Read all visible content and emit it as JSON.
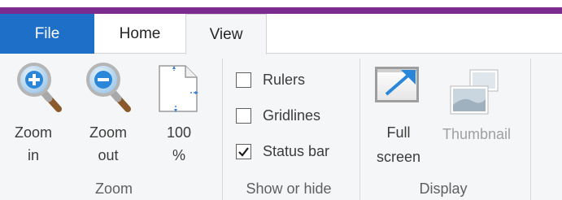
{
  "tabs": {
    "file": "File",
    "home": "Home",
    "view": "View"
  },
  "zoom_group": {
    "zoom_in": {
      "line1": "Zoom",
      "line2": "in"
    },
    "zoom_out": {
      "line1": "Zoom",
      "line2": "out"
    },
    "hundred": {
      "line1": "100",
      "line2": "%"
    },
    "label": "Zoom"
  },
  "show_hide_group": {
    "rulers": {
      "label": "Rulers",
      "checked": false
    },
    "gridlines": {
      "label": "Gridlines",
      "checked": false
    },
    "status_bar": {
      "label": "Status bar",
      "checked": true
    },
    "label": "Show or hide"
  },
  "display_group": {
    "full_screen": {
      "line1": "Full",
      "line2": "screen"
    },
    "thumbnail": {
      "label": "Thumbnail",
      "disabled": true
    },
    "label": "Display"
  },
  "colors": {
    "accent_bar": "#7b2a90",
    "file_tab": "#1e6fc7",
    "ribbon_bg": "#f5f6f7"
  },
  "icons": {
    "zoom_in": "magnifier-plus-icon",
    "zoom_out": "magnifier-minus-icon",
    "hundred": "page-actual-size-icon",
    "full_screen": "full-screen-icon",
    "thumbnail": "thumbnail-icon",
    "check": "check-icon"
  }
}
